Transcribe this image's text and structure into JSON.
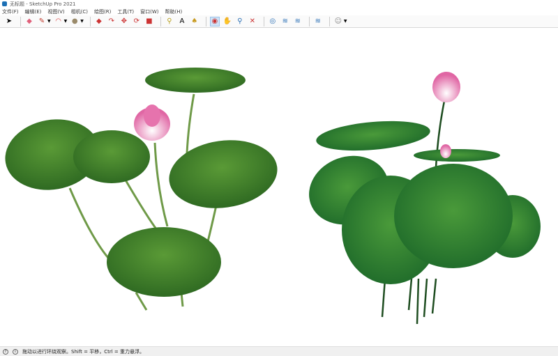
{
  "window": {
    "title": "无标题 - SketchUp Pro 2021"
  },
  "menu": [
    "文件(F)",
    "编辑(E)",
    "视图(V)",
    "相机(C)",
    "绘图(R)",
    "工具(T)",
    "窗口(W)",
    "帮助(H)"
  ],
  "toolbar": {
    "tools": [
      "select",
      "eraser",
      "pencil",
      "arc",
      "paint-bucket",
      "push-pull",
      "follow-me",
      "move",
      "rotate",
      "scale",
      "tape-measure",
      "text",
      "paint",
      "orbit",
      "pan",
      "zoom",
      "zoom-extents",
      "geo-location",
      "add-location",
      "photo-texture",
      "sandbox",
      "account"
    ],
    "active": "orbit"
  },
  "status": {
    "message": "拖动以进行环绕观察。Shift = 平移，Ctrl = 重力悬浮。"
  },
  "colors": {
    "leaf": "#3f7a2a",
    "leaf_light": "#6aa640",
    "petal": "#e77fb0",
    "stem": "#6f9a48"
  }
}
